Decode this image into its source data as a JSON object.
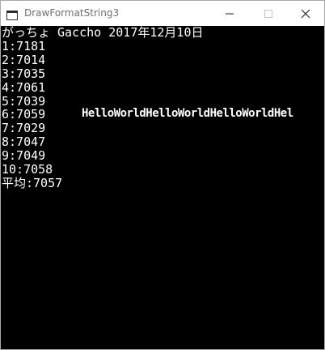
{
  "window": {
    "title": "DrawFormatString3",
    "icon": "app-window-icon",
    "controls": {
      "minimize_icon": "minimize-icon",
      "maximize_icon": "maximize-icon",
      "close_icon": "close-icon"
    }
  },
  "console": {
    "header": "がっちょ Gaccho 2017年12月10日",
    "results": [
      "1:7181",
      "2:7014",
      "3:7035",
      "4:7061",
      "5:7039",
      "6:7059",
      "7:7029",
      "8:7047",
      "9:7049",
      "10:7058"
    ],
    "average": "平均:7057",
    "hello_text": "HelloWorldHelloWorldHelloWorldHel"
  },
  "colors": {
    "background": "#000000",
    "text": "#ffffff",
    "titlebar": "#ffffff",
    "title_text": "#6f6f6f"
  }
}
